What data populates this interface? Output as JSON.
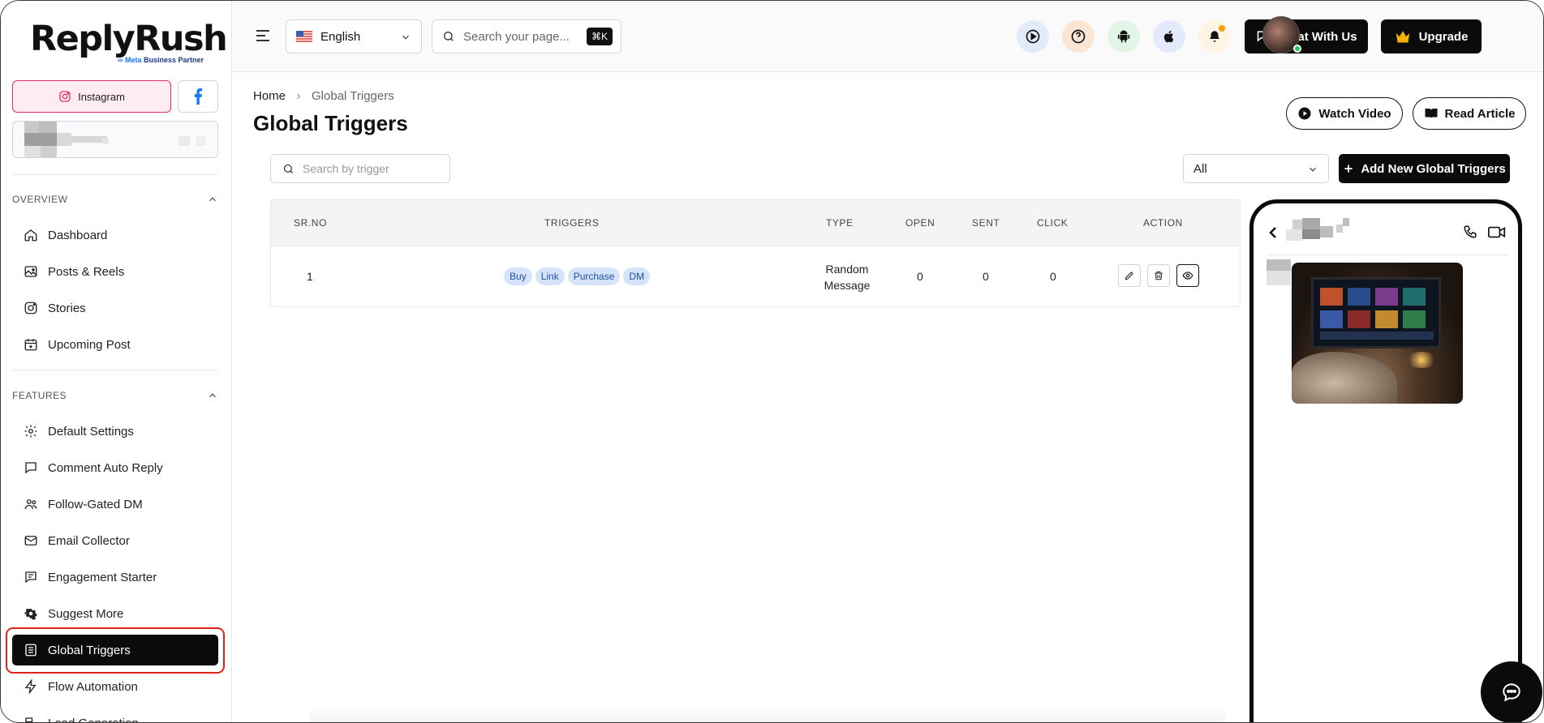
{
  "app": {
    "logo_text": "ReplyRush",
    "logo_sub_meta": "∞ Meta",
    "logo_sub_partner": "Business Partner"
  },
  "sidebar": {
    "platform_instagram": "Instagram",
    "section_overview": "OVERVIEW",
    "overview_items": [
      {
        "label": "Dashboard",
        "icon": "home-icon"
      },
      {
        "label": "Posts & Reels",
        "icon": "image-icon"
      },
      {
        "label": "Stories",
        "icon": "instagram-icon"
      },
      {
        "label": "Upcoming Post",
        "icon": "calendar-plus-icon"
      }
    ],
    "section_features": "FEATURES",
    "feature_items": [
      {
        "label": "Default Settings",
        "icon": "gear-icon"
      },
      {
        "label": "Comment Auto Reply",
        "icon": "comment-icon"
      },
      {
        "label": "Follow-Gated DM",
        "icon": "users-icon"
      },
      {
        "label": "Email Collector",
        "icon": "mail-icon"
      },
      {
        "label": "Engagement Starter",
        "icon": "chat-list-icon"
      },
      {
        "label": "Suggest More",
        "icon": "gear-sparkle-icon"
      },
      {
        "label": "Global Triggers",
        "icon": "document-list-icon",
        "active": true
      },
      {
        "label": "Flow Automation",
        "icon": "bolt-icon"
      },
      {
        "label": "Lead Generation",
        "icon": "lead-icon"
      }
    ]
  },
  "topbar": {
    "language": "English",
    "search_placeholder": "Search your page...",
    "search_shortcut": "⌘K",
    "chat_button": "Chat With Us",
    "upgrade_button": "Upgrade"
  },
  "main": {
    "breadcrumb_home": "Home",
    "breadcrumb_current": "Global Triggers",
    "title": "Global Triggers",
    "watch_video": "Watch Video",
    "read_article": "Read Article",
    "trigger_search_placeholder": "Search by trigger",
    "filter_value": "All",
    "add_button": "Add New Global Triggers",
    "table": {
      "headers": {
        "srno": "SR.NO",
        "triggers": "TRIGGERS",
        "type": "TYPE",
        "open": "OPEN",
        "sent": "SENT",
        "click": "CLICK",
        "action": "ACTION"
      },
      "rows": [
        {
          "srno": "1",
          "tags": [
            "Buy",
            "Link",
            "Purchase",
            "DM"
          ],
          "type_line1": "Random",
          "type_line2": "Message",
          "open": "0",
          "sent": "0",
          "click": "0"
        }
      ]
    }
  },
  "colors": {
    "accent": "#0b0b0b",
    "instagram": "#e1306c",
    "facebook": "#1877f2",
    "tag_bg": "#d6e4fb",
    "highlight": "#e0211c"
  }
}
